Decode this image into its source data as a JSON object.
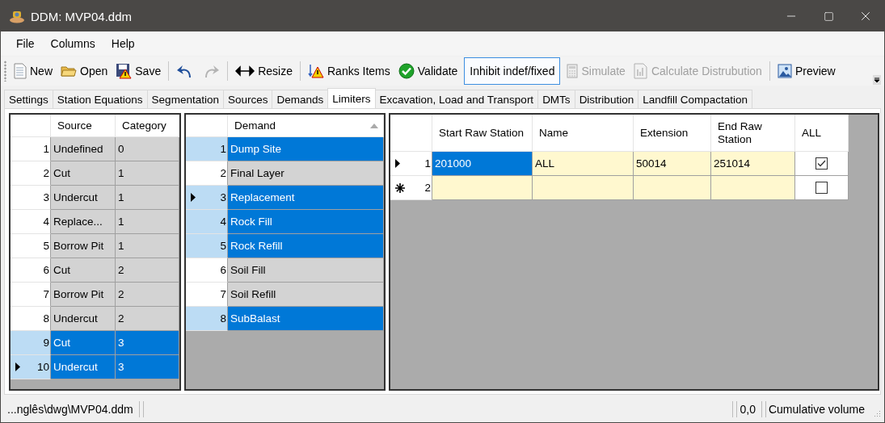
{
  "window": {
    "title": "DDM: MVP04.ddm"
  },
  "menu": [
    "File",
    "Columns",
    "Help"
  ],
  "toolbar": [
    {
      "kind": "button",
      "label": "New",
      "disabled": false
    },
    {
      "kind": "button",
      "label": "Open",
      "disabled": false
    },
    {
      "kind": "button",
      "label": "Save",
      "disabled": false
    },
    {
      "kind": "separator"
    },
    {
      "kind": "icon",
      "disabled": false
    },
    {
      "kind": "icon",
      "disabled": true
    },
    {
      "kind": "separator"
    },
    {
      "kind": "button",
      "label": "Resize",
      "disabled": false
    },
    {
      "kind": "separator"
    },
    {
      "kind": "button",
      "label": "Ranks Items",
      "disabled": false
    },
    {
      "kind": "button",
      "label": "Validate",
      "disabled": false
    },
    {
      "kind": "toggle",
      "label": "Inhibit indef/fixed",
      "checked": true
    },
    {
      "kind": "button",
      "label": "Simulate",
      "disabled": true
    },
    {
      "kind": "button",
      "label": "Calculate Distrubution",
      "disabled": true
    },
    {
      "kind": "separator"
    },
    {
      "kind": "button",
      "label": "Preview",
      "disabled": false
    }
  ],
  "tabs": [
    {
      "label": "Settings",
      "selected": false
    },
    {
      "label": "Station Equations",
      "selected": false
    },
    {
      "label": "Segmentation",
      "selected": false
    },
    {
      "label": "Sources",
      "selected": false
    },
    {
      "label": "Demands",
      "selected": false
    },
    {
      "label": "Limiters",
      "selected": true
    },
    {
      "label": "Excavation, Load and Transport",
      "selected": false
    },
    {
      "label": "DMTs",
      "selected": false
    },
    {
      "label": "Distribution",
      "selected": false
    },
    {
      "label": "Landfill Compactation",
      "selected": false
    }
  ],
  "grids": [
    {
      "columns": [
        {
          "label": "Source",
          "kind": "text"
        },
        {
          "label": "Category",
          "kind": "text"
        }
      ],
      "rows": [
        {
          "number": "1",
          "current": false,
          "selected": false,
          "cells": [
            "Undefined",
            "0"
          ]
        },
        {
          "number": "2",
          "current": false,
          "selected": false,
          "cells": [
            "Cut",
            "1"
          ]
        },
        {
          "number": "3",
          "current": false,
          "selected": false,
          "cells": [
            "Undercut",
            "1"
          ]
        },
        {
          "number": "4",
          "current": false,
          "selected": false,
          "cells": [
            "Replace...",
            "1"
          ]
        },
        {
          "number": "5",
          "current": false,
          "selected": false,
          "cells": [
            "Borrow Pit",
            "1"
          ]
        },
        {
          "number": "6",
          "current": false,
          "selected": false,
          "cells": [
            "Cut",
            "2"
          ]
        },
        {
          "number": "7",
          "current": false,
          "selected": false,
          "cells": [
            "Borrow Pit",
            "2"
          ]
        },
        {
          "number": "8",
          "current": false,
          "selected": false,
          "cells": [
            "Undercut",
            "2"
          ]
        },
        {
          "number": "9",
          "current": false,
          "selected": true,
          "cells": [
            "Cut",
            "3"
          ]
        },
        {
          "number": "10",
          "current": true,
          "selected": true,
          "cells": [
            "Undercut",
            "3"
          ]
        }
      ]
    },
    {
      "columns": [
        {
          "label": "Demand",
          "kind": "text",
          "sorted": true
        }
      ],
      "rows": [
        {
          "number": "1",
          "current": false,
          "selected": true,
          "cells": [
            "Dump Site"
          ]
        },
        {
          "number": "2",
          "current": false,
          "selected": false,
          "cells": [
            "Final Layer"
          ]
        },
        {
          "number": "3",
          "current": true,
          "selected": true,
          "cells": [
            "Replacement"
          ]
        },
        {
          "number": "4",
          "current": false,
          "selected": true,
          "cells": [
            "Rock Fill"
          ]
        },
        {
          "number": "5",
          "current": false,
          "selected": true,
          "cells": [
            "Rock Refill"
          ]
        },
        {
          "number": "6",
          "current": false,
          "selected": false,
          "cells": [
            "Soil Fill"
          ]
        },
        {
          "number": "7",
          "current": false,
          "selected": false,
          "cells": [
            "Soil Refill"
          ]
        },
        {
          "number": "8",
          "current": false,
          "selected": true,
          "cells": [
            "SubBalast"
          ]
        }
      ]
    },
    {
      "columns": [
        {
          "label": "Start Raw Station",
          "kind": "text"
        },
        {
          "label": "Name",
          "kind": "text"
        },
        {
          "label": "Extension",
          "kind": "text"
        },
        {
          "label": "End Raw Station",
          "kind": "text"
        },
        {
          "label": "ALL",
          "kind": "check"
        }
      ],
      "rows": [
        {
          "number": "1",
          "current": true,
          "new": false,
          "selected": false,
          "checked": true,
          "cells": [
            {
              "text": "201000",
              "selected": true
            },
            {
              "text": "ALL",
              "selected": false
            },
            {
              "text": "50014",
              "selected": false
            },
            {
              "text": "251014",
              "selected": false
            }
          ]
        },
        {
          "number": "2",
          "current": false,
          "new": true,
          "selected": false,
          "checked": false,
          "cells": [
            {
              "selected": false
            },
            {
              "selected": false
            },
            {
              "selected": false
            },
            {
              "selected": false
            }
          ]
        }
      ]
    }
  ],
  "status_bar": [
    "...nglês\\dwg\\MVP04.ddm",
    "0,0",
    "Cumulative volume"
  ]
}
